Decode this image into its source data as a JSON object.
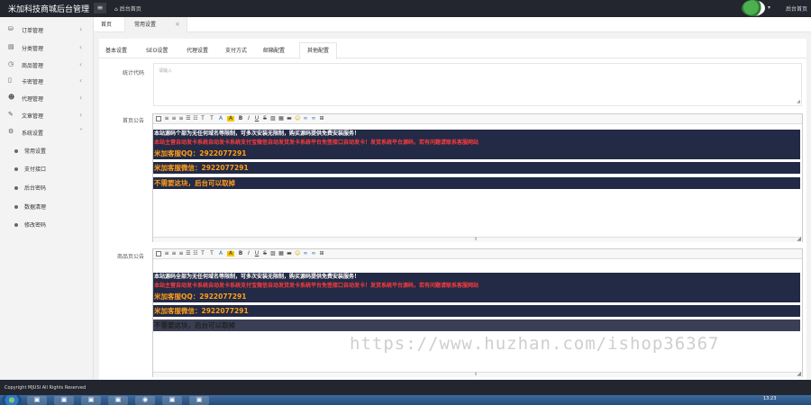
{
  "header": {
    "brand": "米加科技商城后台管理",
    "menu_toggle": "≡",
    "home_link": "⌂ 后台首页",
    "right_home": "后台首页"
  },
  "sidebar": {
    "items": [
      {
        "label": "订单管理",
        "icon": "database-icon"
      },
      {
        "label": "分类管理",
        "icon": "folder-icon"
      },
      {
        "label": "商品管理",
        "icon": "clock-icon"
      },
      {
        "label": "卡密管理",
        "icon": "file-icon"
      },
      {
        "label": "代理管理",
        "icon": "users-icon"
      },
      {
        "label": "文章管理",
        "icon": "edit-icon"
      },
      {
        "label": "系统设置",
        "icon": "gear-icon"
      }
    ],
    "subitems": [
      {
        "label": "常用设置"
      },
      {
        "label": "支付接口"
      },
      {
        "label": "后台密码"
      },
      {
        "label": "数据清理"
      },
      {
        "label": "修改密码"
      }
    ]
  },
  "page_tabs": [
    {
      "label": "首页"
    },
    {
      "label": "常用设置",
      "close": "×"
    }
  ],
  "subtabs": [
    "基本设置",
    "SEO设置",
    "代理设置",
    "支付方式",
    "邮箱配置",
    "其他配置"
  ],
  "form": {
    "textarea_label": "统计代码",
    "textarea_placeholder": "请输入",
    "editor1_label": "首页公告",
    "editor2_label": "商品页公告",
    "resize_glyph": "◢",
    "grip_glyph": "⇕"
  },
  "toolbar": {
    "fg_label": "A",
    "bg_label": "A",
    "bold": "B",
    "italic": "I",
    "underline": "U",
    "strike": "S",
    "size_up": "T",
    "size_down": "T"
  },
  "editor1": {
    "line1": "本站源码个部为无任何域名等限制，可多次安装无限制，购买源码提供免费安装服务！",
    "line2": "本站主营自动发卡系统自动发卡系统支付宝微信自动发货发卡系统平台免签接口自动发卡！发货系统平台源码，若有问题请联系客服网站",
    "line3": "米加客服QQ：2922077291",
    "line4": "米加客服微信：2922077291",
    "line5": "不需要这块，后台可以取掉"
  },
  "editor2": {
    "line1": "本站源码全部为无任何域名等限制，可多次安装无限制，购买源码提供免费安装服务！",
    "line2": "本站主营自动发卡系统自动发卡系统支付宝微信自动发货发卡系统平台免签接口自动发卡！发货系统平台源码，若有问题请联系客服网站",
    "line3": "米加客服QQ：2922077291",
    "line4": "米加客服微信：2922077291",
    "line5": "不需要这块，后台可以取掉"
  },
  "watermark": "https://www.huzhan.com/ishop36367",
  "footer": {
    "copyright": "Copyright MJUSI All Rights Reserved"
  },
  "taskbar": {
    "clock": "13:23"
  },
  "colors": {
    "header_bg": "#23262e",
    "editor_dark_bg": "#232a45",
    "text_orange": "#ff9e1b",
    "text_red": "#ff3b3b"
  }
}
